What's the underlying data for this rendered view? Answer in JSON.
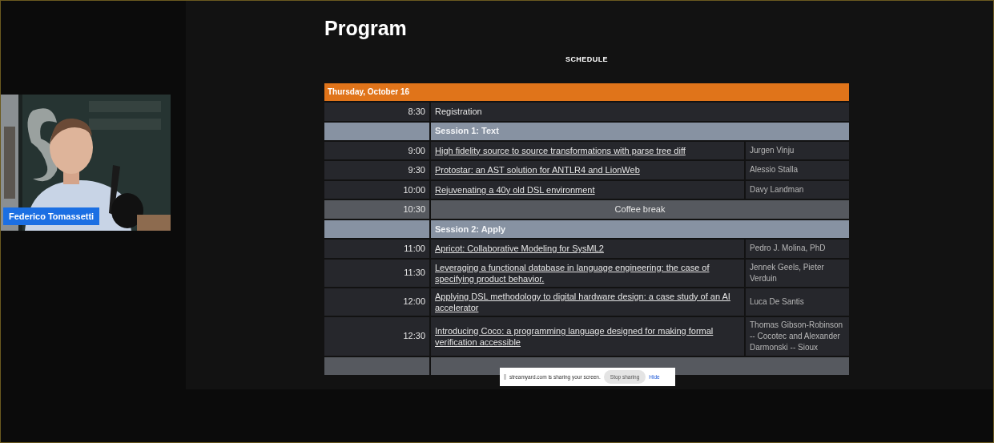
{
  "camera": {
    "kind": "picture",
    "name_tag": "Federico Tomassetti"
  },
  "page": {
    "title": "Program",
    "subtitle": "SCHEDULE"
  },
  "schedule": {
    "day": "Thursday, October 16",
    "rows": [
      {
        "kind": "plain",
        "time": "8:30",
        "title": "Registration"
      },
      {
        "kind": "session",
        "title": "Session 1: Text"
      },
      {
        "kind": "talk",
        "time": "9:00",
        "title": "High fidelity source to source transformations with parse tree diff",
        "speaker": "Jurgen Vinju"
      },
      {
        "kind": "talk",
        "time": "9:30",
        "title": "Protostar: an AST solution for ANTLR4 and LionWeb",
        "speaker": "Alessio Stalla"
      },
      {
        "kind": "talk",
        "time": "10:00",
        "title": "Rejuvenating a 40y old DSL environment",
        "speaker": "Davy Landman"
      },
      {
        "kind": "break",
        "time": "10:30",
        "title": "Coffee break"
      },
      {
        "kind": "session",
        "title": "Session 2: Apply"
      },
      {
        "kind": "talk",
        "time": "11:00",
        "title": "Apricot: Collaborative Modeling for SysML2",
        "speaker": "Pedro J. Molina, PhD"
      },
      {
        "kind": "talk",
        "time": "11:30",
        "title": "Leveraging a functional database in language engineering: the case of specifying product behavior.",
        "speaker": "Jennek Geels, Pieter Verduin"
      },
      {
        "kind": "talk",
        "time": "12:00",
        "title": "Applying DSL methodology to digital hardware design: a case study of an AI accelerator",
        "speaker": "Luca De Santis"
      },
      {
        "kind": "talk",
        "time": "12:30",
        "title": "Introducing Coco: a programming language designed for making formal verification accessible",
        "speaker": "Thomas Gibson-Robinson -- Cocotec and Alexander Darmonski -- Sioux"
      },
      {
        "kind": "empty"
      }
    ]
  },
  "share_bar": {
    "message": "streamyard.com is sharing your screen.",
    "stop_button": "Stop sharing",
    "hide_link": "Hide"
  }
}
